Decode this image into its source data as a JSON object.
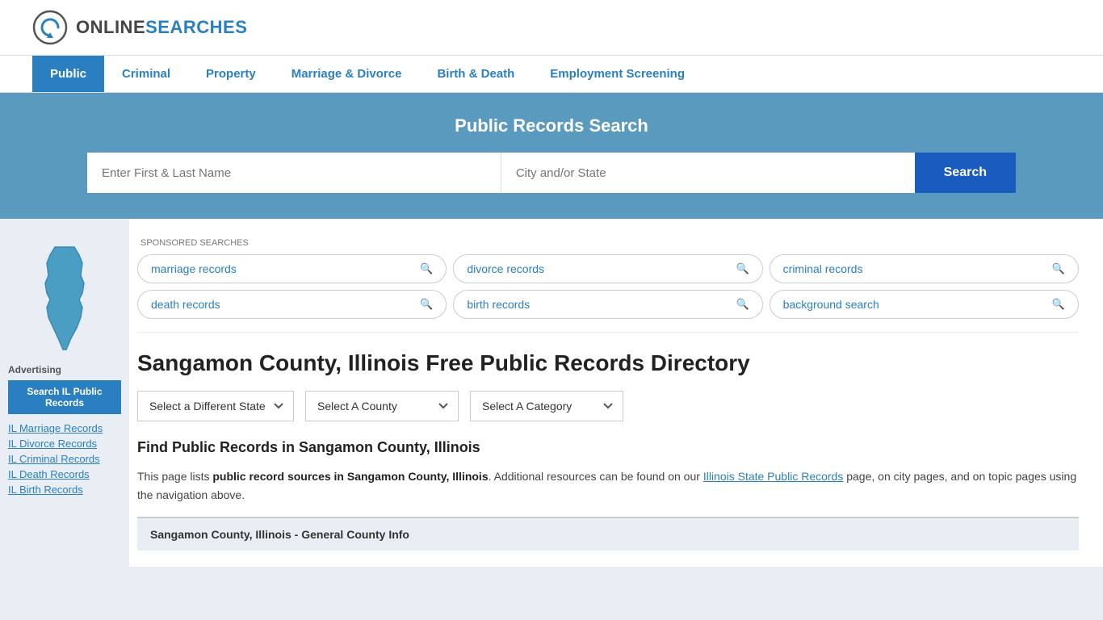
{
  "header": {
    "logo_online": "ONLINE",
    "logo_searches": "SEARCHES"
  },
  "nav": {
    "items": [
      {
        "label": "Public",
        "active": true
      },
      {
        "label": "Criminal",
        "active": false
      },
      {
        "label": "Property",
        "active": false
      },
      {
        "label": "Marriage & Divorce",
        "active": false
      },
      {
        "label": "Birth & Death",
        "active": false
      },
      {
        "label": "Employment Screening",
        "active": false
      }
    ]
  },
  "search_banner": {
    "title": "Public Records Search",
    "name_placeholder": "Enter First & Last Name",
    "location_placeholder": "City and/or State",
    "search_button": "Search"
  },
  "sponsored": {
    "label": "SPONSORED SEARCHES",
    "pills": [
      {
        "label": "marriage records"
      },
      {
        "label": "divorce records"
      },
      {
        "label": "criminal records"
      },
      {
        "label": "death records"
      },
      {
        "label": "birth records"
      },
      {
        "label": "background search"
      }
    ]
  },
  "page": {
    "title": "Sangamon County, Illinois Free Public Records Directory",
    "find_heading": "Find Public Records in Sangamon County, Illinois",
    "description_part1": "This page lists ",
    "description_bold": "public record sources in Sangamon County, Illinois",
    "description_part2": ". Additional resources can be found on our ",
    "description_link": "Illinois State Public Records",
    "description_part3": " page, on city pages, and on topic pages using the navigation above.",
    "county_info_bar": "Sangamon County, Illinois - General County Info"
  },
  "dropdowns": {
    "state_label": "Select a Different State",
    "county_label": "Select A County",
    "category_label": "Select A Category"
  },
  "sidebar": {
    "ad_label": "Advertising",
    "ad_button": "Search IL Public Records",
    "links": [
      "IL Marriage Records",
      "IL Divorce Records",
      "IL Criminal Records",
      "IL Death Records",
      "IL Birth Records"
    ]
  }
}
